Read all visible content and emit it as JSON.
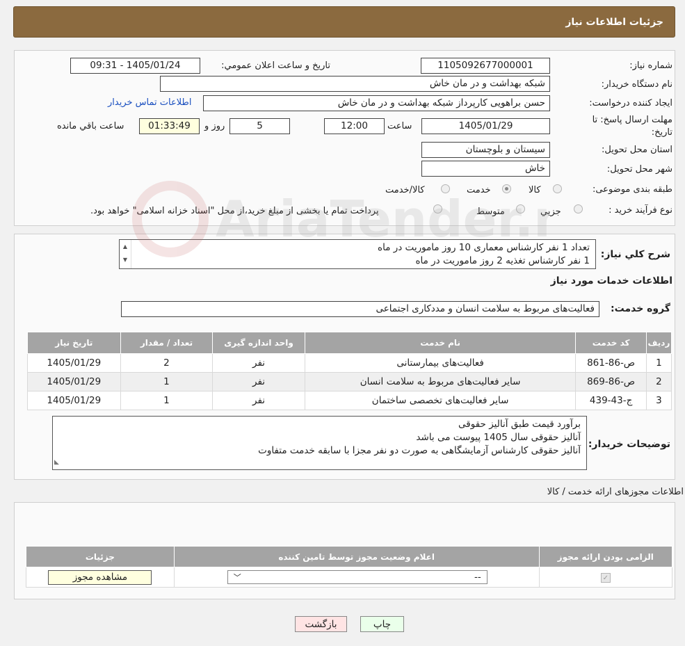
{
  "header": {
    "title": "جزئیات اطلاعات نیاز"
  },
  "form": {
    "need_number": {
      "label": "شماره نیاز:",
      "value": "1105092677000001"
    },
    "announce": {
      "label": "تاریخ و ساعت اعلان عمومي:",
      "value": "1405/01/24 - 09:31"
    },
    "buyer": {
      "label": "نام دستگاه خريدار:",
      "value": "شبکه بهداشت و در مان خاش"
    },
    "creator": {
      "label": "ایجاد کننده درخواست:",
      "value": "حسن براهویی کارپرداز شبکه بهداشت و در مان خاش",
      "contact_link": "اطلاعات تماس خريدار"
    },
    "deadline": {
      "label_line1": "مهلت ارسال پاسخ: تا",
      "label_line2": "تاريخ:",
      "date": "1405/01/29",
      "time_label": "ساعت",
      "time": "12:00",
      "days": "5",
      "days_label": "روز و",
      "remaining": "01:33:49",
      "remaining_label": "ساعت باقي مانده"
    },
    "province": {
      "label": "استان محل تحویل:",
      "value": "سیستان و بلوچستان"
    },
    "city": {
      "label": "شهر محل تحویل:",
      "value": "خاش"
    },
    "category": {
      "label": "طبقه بندی موضوعی:",
      "options": [
        "کالا",
        "خدمت",
        "کالا/خدمت"
      ],
      "selected": "خدمت"
    },
    "purchase_type": {
      "label": "نوع فرآیند خرید :",
      "options": [
        "جزیي",
        "متوسط"
      ],
      "note": "پرداخت تمام يا بخشی از مبلغ خريد،از محل \"اسناد خزانه اسلامی\" خواهد بود."
    }
  },
  "description": {
    "label": "شرح کلي نياز:",
    "lines": [
      "تعداد 1 نفر کارشناس معماری 10 روز ماموریت در ماه",
      "1 نفر کارشناس تغذیه 2 روز ماموریت در ماه"
    ]
  },
  "services": {
    "section_title": "اطلاعات خدمات مورد نياز",
    "group_label": "گروه خدمت:",
    "group_value": "فعالیت‌های مربوط به سلامت انسان و مددکاری اجتماعی",
    "columns": [
      "ردیف",
      "کد خدمت",
      "نام خدمت",
      "واحد اندازه گیری",
      "تعداد / مقدار",
      "تاريخ نياز"
    ],
    "rows": [
      [
        "1",
        "ص-86-861",
        "فعالیت‌های بیمارستانی",
        "نفر",
        "2",
        "1405/01/29"
      ],
      [
        "2",
        "ص-86-869",
        "سایر فعالیت‌های مربوط به سلامت انسان",
        "نفر",
        "1",
        "1405/01/29"
      ],
      [
        "3",
        "ج-43-439",
        "سایر فعالیت‌های تخصصی ساختمان",
        "نفر",
        "1",
        "1405/01/29"
      ]
    ]
  },
  "buyer_notes": {
    "label": "توضیحات خریدار:",
    "lines": [
      "برآورد قیمت طبق آنالیز حقوقی",
      "آنالیز حقوقی سال 1405 پیوست می باشد",
      "آنالیز حقوقی کارشناس آزمایشگاهی به صورت دو نفر مجزا با سابقه خدمت متفاوت"
    ]
  },
  "permits": {
    "title": "اطلاعات مجوزهای ارائه خدمت / کالا",
    "columns": [
      "الزامی بودن ارائه مجوز",
      "اعلام وضعیت مجوز توسط تامین کننده",
      "جزئیات"
    ],
    "select_value": "--",
    "view_button": "مشاهده مجوز"
  },
  "footer": {
    "print": "چاپ",
    "back": "بازگشت"
  },
  "watermark": {
    "text": "AriaTender.neT"
  }
}
